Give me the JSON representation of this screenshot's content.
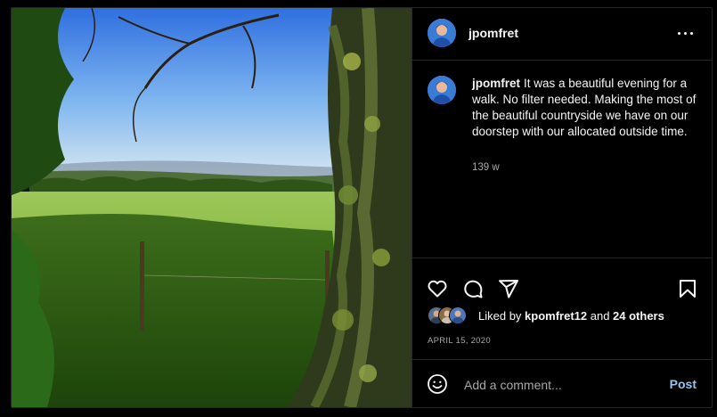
{
  "colors": {
    "background": "#000000",
    "border": "#262626",
    "text_primary": "#f5f5f5",
    "text_secondary": "#a8a8a8",
    "post_button": "#8ec6f5"
  },
  "post": {
    "photo_alt": "Countryside field seen through an ivy-covered tree",
    "header": {
      "username": "jpomfret",
      "more_icon": "more-horizontal-icon"
    },
    "caption": {
      "username": "jpomfret",
      "text": "It was a beautiful evening for a walk. No filter needed. Making the most of the beautiful countryside we have on our doorstep with our allocated outside time.",
      "time_ago": "139 w"
    },
    "actions": {
      "like_icon": "heart-icon",
      "comment_icon": "comment-icon",
      "share_icon": "share-icon",
      "save_icon": "bookmark-icon"
    },
    "likes": {
      "prefix": "Liked by ",
      "user": "kpomfret12",
      "connector": " and ",
      "others": "24 others"
    },
    "date": "APRIL 15, 2020",
    "comment": {
      "emoji_icon": "emoji-icon",
      "placeholder": "Add a comment...",
      "post_label": "Post"
    }
  }
}
